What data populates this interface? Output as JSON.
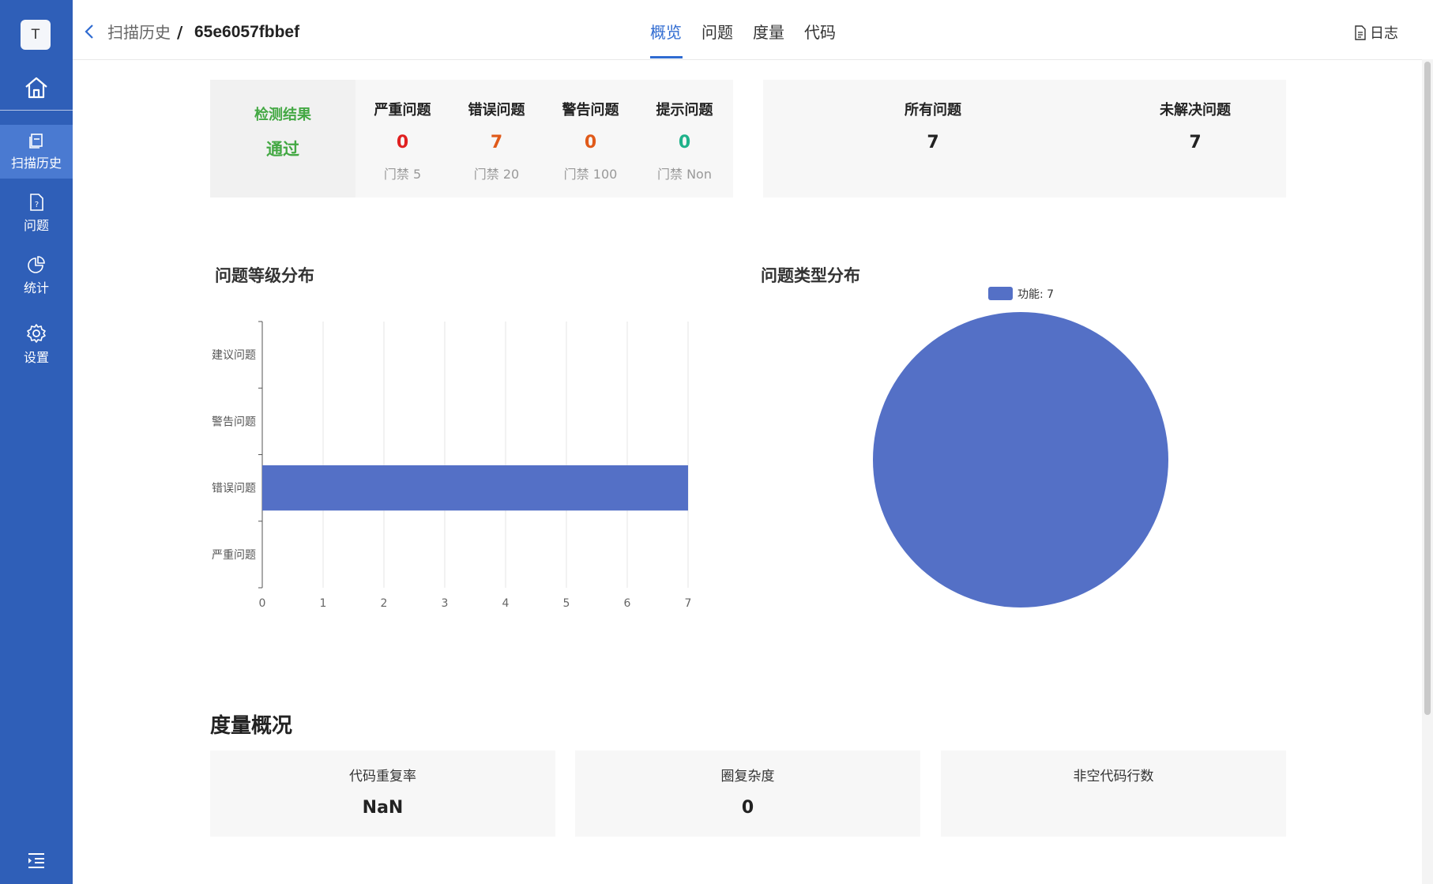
{
  "sidebar": {
    "avatar": "T",
    "items": [
      {
        "label": "",
        "icon": "home-icon"
      },
      {
        "label": "扫描历史",
        "icon": "history-icon"
      },
      {
        "label": "问题",
        "icon": "issue-file-icon"
      },
      {
        "label": "统计",
        "icon": "pie-chart-icon"
      },
      {
        "label": "设置",
        "icon": "gear-icon"
      }
    ],
    "collapse_icon": "menu-indent-icon"
  },
  "header": {
    "breadcrumb_parent": "扫描历史",
    "breadcrumb_separator": "/",
    "breadcrumb_current": "65e6057fbbef",
    "tabs": [
      "概览",
      "问题",
      "度量",
      "代码"
    ],
    "active_tab": "概览",
    "log_label": "日志"
  },
  "summary": {
    "result_title": "检测结果",
    "result_value": "通过",
    "metrics": [
      {
        "title": "严重问题",
        "value": "0",
        "gate": "门禁 5",
        "color": "#e02020"
      },
      {
        "title": "错误问题",
        "value": "7",
        "gate": "门禁 20",
        "color": "#e05a1a"
      },
      {
        "title": "警告问题",
        "value": "0",
        "gate": "门禁 100",
        "color": "#e05a1a"
      },
      {
        "title": "提示问题",
        "value": "0",
        "gate": "门禁 Non",
        "color": "#1fb28a"
      }
    ],
    "all_issues_title": "所有问题",
    "all_issues_value": "7",
    "unresolved_title": "未解决问题",
    "unresolved_value": "7"
  },
  "sections": {
    "level_title": "问题等级分布",
    "type_title": "问题类型分布",
    "measure_title": "度量概况"
  },
  "chart_data": [
    {
      "type": "bar",
      "orientation": "horizontal",
      "categories": [
        "严重问题",
        "错误问题",
        "警告问题",
        "建议问题"
      ],
      "values": [
        0,
        7,
        0,
        0
      ],
      "xlim": [
        0,
        7
      ],
      "xticks": [
        0,
        1,
        2,
        3,
        4,
        5,
        6,
        7
      ],
      "grid": true,
      "color": "#5470c6"
    },
    {
      "type": "pie",
      "legend": [
        "功能: 7"
      ],
      "legend_position": "top",
      "slices": [
        {
          "label": "功能",
          "value": 7
        }
      ],
      "color": "#5470c6"
    }
  ],
  "measures": [
    {
      "title": "代码重复率",
      "value": "NaN"
    },
    {
      "title": "圈复杂度",
      "value": "0"
    },
    {
      "title": "非空代码行数",
      "value": ""
    }
  ],
  "colors": {
    "sidebar": "#2f5fb8",
    "accent": "#2f6bd1",
    "pass": "#43a843"
  }
}
